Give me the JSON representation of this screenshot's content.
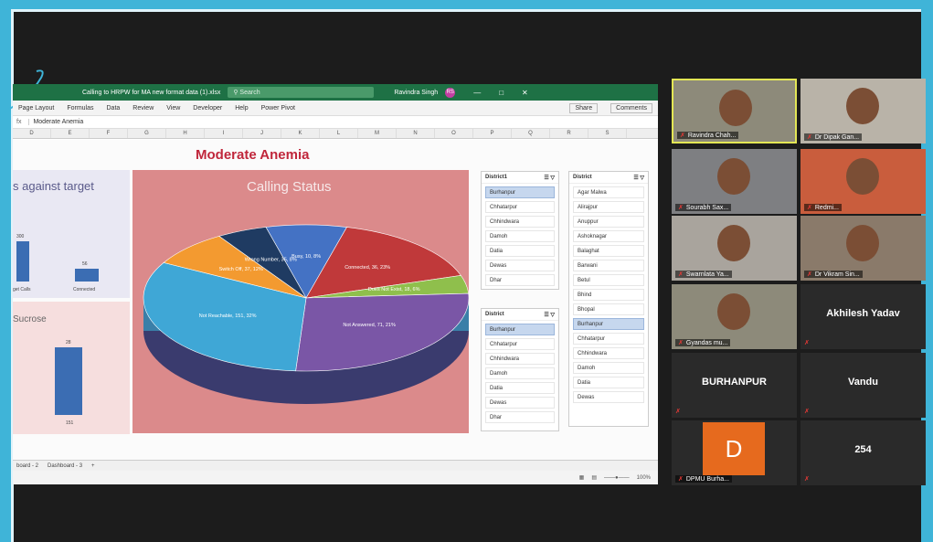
{
  "excel": {
    "file_title": "Calling to HRPW for  MA new format data (1).xlsx",
    "search_placeholder": "Search",
    "user_name": "Ravindra Singh",
    "user_initials": "RS",
    "ribbon_tabs": [
      "Page Layout",
      "Formulas",
      "Data",
      "Review",
      "View",
      "Developer",
      "Help",
      "Power Pivot"
    ],
    "share_label": "Share",
    "comments_label": "Comments",
    "formula_value": "Moderate Anemia",
    "columns": [
      "D",
      "E",
      "F",
      "G",
      "H",
      "I",
      "J",
      "K",
      "L",
      "M",
      "N",
      "O",
      "P",
      "Q",
      "R",
      "S"
    ],
    "sheet_title": "Moderate Anemia",
    "left_top_title": "s against target",
    "left_top_labels": [
      "300",
      "56",
      "get Calls",
      "Connected"
    ],
    "left_bottom_title": "Sucrose",
    "left_bottom_labels": [
      "28",
      "151"
    ],
    "sheet_tabs": [
      "board - 2",
      "Dashboard - 3",
      "+"
    ],
    "zoom": "100%"
  },
  "chart_data": {
    "type": "pie",
    "title": "Calling Status",
    "slices": [
      {
        "label": "Busy, 10, 8%",
        "value": 8,
        "color": "#4472c4"
      },
      {
        "label": "Connected, 36, 23%",
        "value": 16,
        "color": "#c0393a"
      },
      {
        "label": "Does Not Exist, 18, 6%",
        "value": 4,
        "color": "#8fbf4c"
      },
      {
        "label": "Not Answered, 71, 21%",
        "value": 27,
        "color": "#7a56a6"
      },
      {
        "label": "Not Reachable, 151, 32%",
        "value": 32,
        "color": "#3fa7d6"
      },
      {
        "label": "Switch Off, 37, 12%",
        "value": 8,
        "color": "#f39a30"
      },
      {
        "label": "Wrong Number, 35, 8%",
        "value": 5,
        "color": "#1f3b62"
      }
    ]
  },
  "slicers": {
    "district1": {
      "title": "District1",
      "items": [
        "Burhanpur",
        "Chhatarpur",
        "Chhindwara",
        "Damoh",
        "Datia",
        "Dewas",
        "Dhar"
      ],
      "selected": 0
    },
    "district_a": {
      "title": "District",
      "items": [
        "Burhanpur",
        "Chhatarpur",
        "Chhindwara",
        "Damoh",
        "Datia",
        "Dewas",
        "Dhar"
      ],
      "selected": 0
    },
    "district_b": {
      "title": "District",
      "items": [
        "Agar Malwa",
        "Alirajpur",
        "Anuppur",
        "Ashoknagar",
        "Balaghat",
        "Barwani",
        "Betul",
        "Bhind",
        "Bhopal",
        "Burhanpur",
        "Chhatarpur",
        "Chhindwara",
        "Damoh",
        "Datia",
        "Dewas"
      ],
      "selected": 9
    }
  },
  "participants": [
    {
      "name": "Ravindra Chah...",
      "active": true
    },
    {
      "name": "Dr Dipak Gan..."
    },
    {
      "name": "Sourabh Sax..."
    },
    {
      "name": "Redmi..."
    },
    {
      "name": "Swarnlata Ya..."
    },
    {
      "name": "Dr Vikram Sin..."
    },
    {
      "name": "Gyandas mu..."
    },
    {
      "name": "Akhilesh Yadav"
    },
    {
      "name": "BURHANPUR"
    },
    {
      "name": "Vandu"
    },
    {
      "name": "DPMU Burha..."
    },
    {
      "name": "254"
    }
  ],
  "dpmu_initial": "D"
}
